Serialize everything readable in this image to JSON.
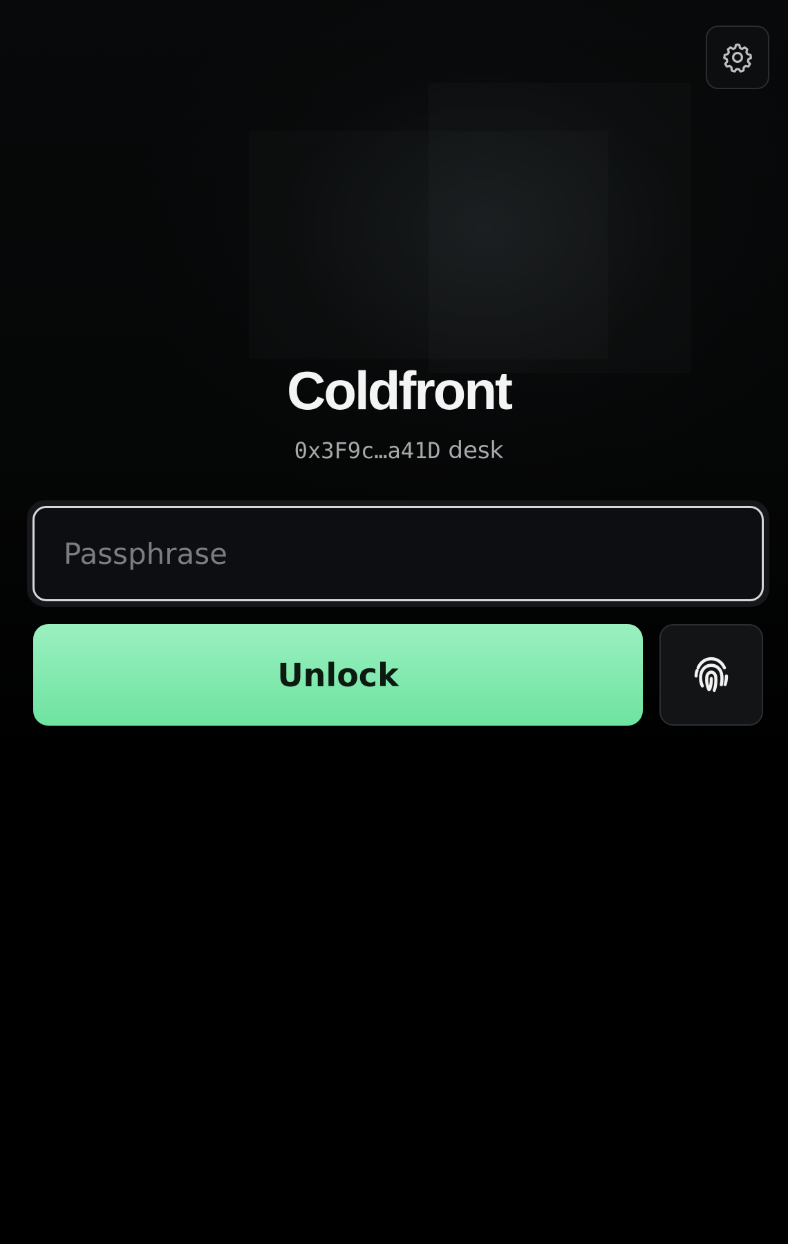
{
  "app": {
    "title": "Coldfront",
    "wallet_address": "0x3F9c…a41D",
    "wallet_label": "desk"
  },
  "settings": {
    "icon": "gear-icon"
  },
  "passphrase": {
    "value": "",
    "placeholder": "Passphrase"
  },
  "actions": {
    "unlock_label": "Unlock",
    "biometric_icon": "fingerprint-icon"
  },
  "colors": {
    "accent": "#7ce8a9",
    "background": "#000000",
    "unlock_text": "#0c1a12"
  }
}
